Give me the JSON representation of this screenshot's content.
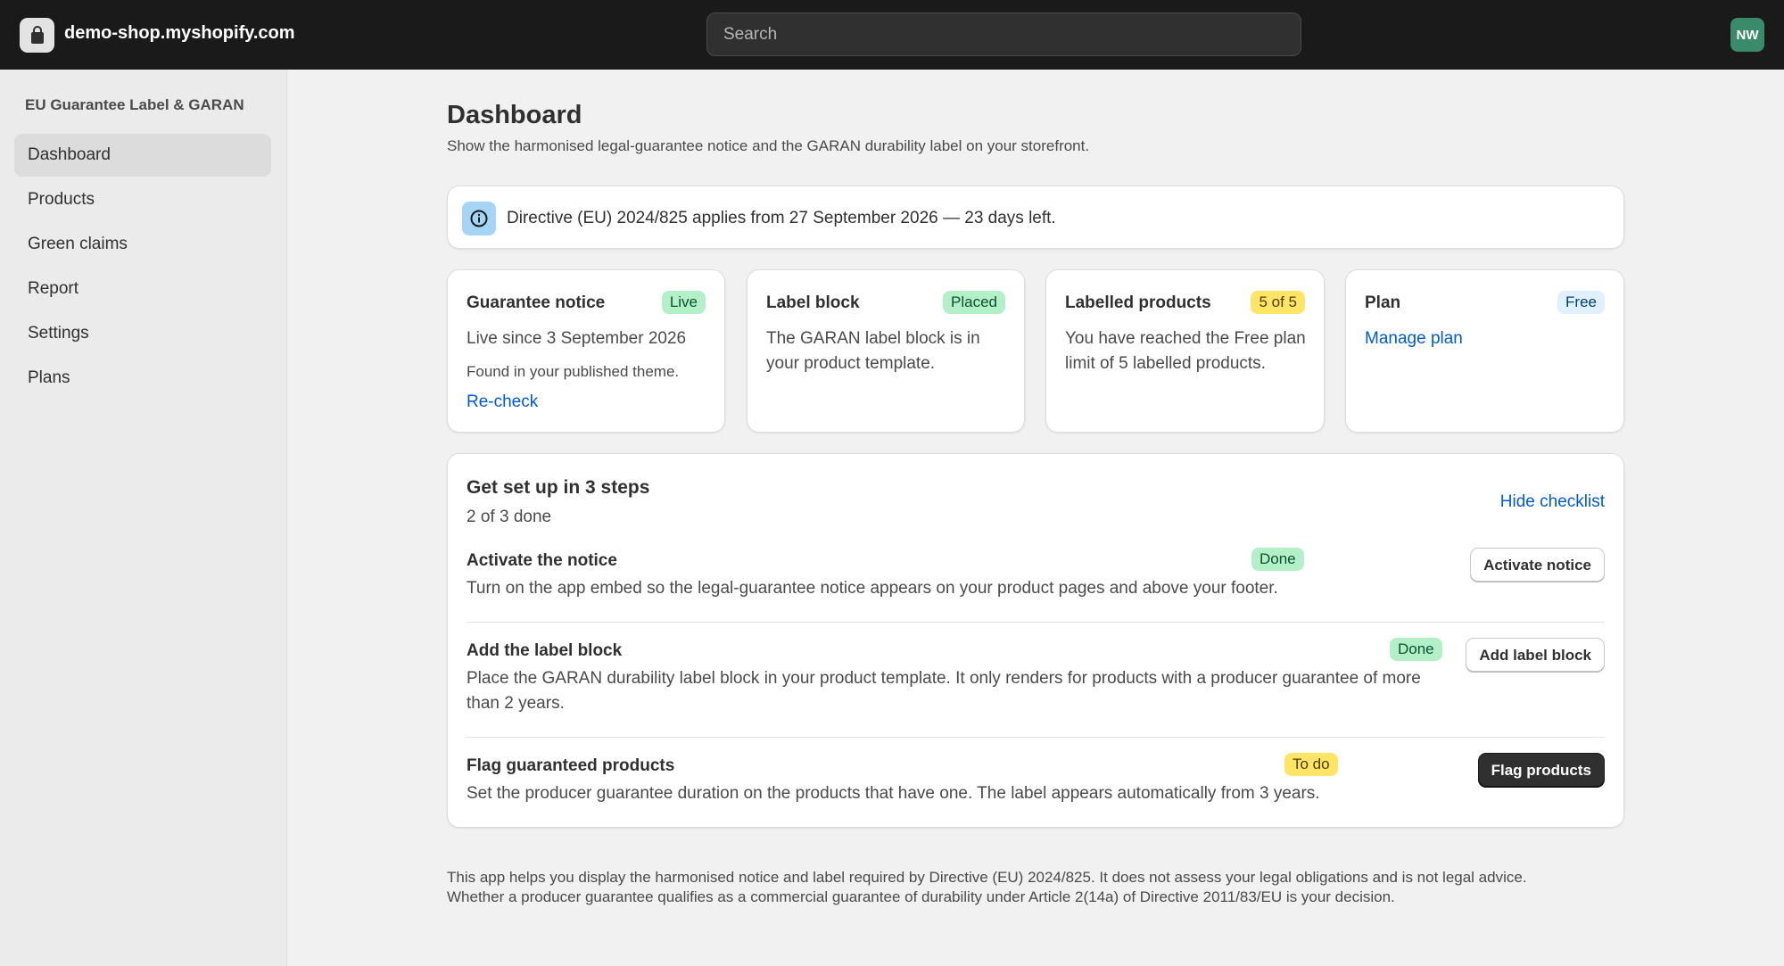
{
  "topbar": {
    "store_name": "demo-shop.myshopify.com",
    "search_placeholder": "Search",
    "avatar_initials": "NW"
  },
  "sidebar": {
    "app_name": "EU Guarantee Label & GARAN",
    "items": [
      {
        "label": "Dashboard",
        "active": true
      },
      {
        "label": "Products"
      },
      {
        "label": "Green claims"
      },
      {
        "label": "Report"
      },
      {
        "label": "Settings"
      },
      {
        "label": "Plans"
      }
    ]
  },
  "page": {
    "title": "Dashboard",
    "subtitle": "Show the harmonised legal-guarantee notice and the GARAN durability label on your storefront."
  },
  "banner": {
    "text": "Directive (EU) 2024/825 applies from 27 September 2026 — 23 days left."
  },
  "cards": {
    "notice": {
      "title": "Guarantee notice",
      "badge": "Live",
      "body": "Live since 3 September 2026",
      "small": "Found in your published theme.",
      "link": "Re-check"
    },
    "label": {
      "title": "Label block",
      "badge": "Placed",
      "body": "The GARAN label block is in your product template."
    },
    "products": {
      "title": "Labelled products",
      "badge": "5 of 5",
      "body": "You have reached the Free plan limit of 5 labelled products."
    },
    "plan": {
      "title": "Plan",
      "badge": "Free",
      "link": "Manage plan"
    }
  },
  "setup": {
    "title": "Get set up in 3 steps",
    "count": "2 of 3 done",
    "hide_link": "Hide checklist",
    "steps": [
      {
        "title": "Activate the notice",
        "badge": "Done",
        "desc": "Turn on the app embed so the legal-guarantee notice appears on your product pages and above your footer.",
        "button": "Activate notice"
      },
      {
        "title": "Add the label block",
        "badge": "Done",
        "desc": "Place the GARAN durability label block in your product template. It only renders for products with a producer guarantee of more than 2 years.",
        "button": "Add label block"
      },
      {
        "title": "Flag guaranteed products",
        "badge": "To do",
        "desc": "Set the producer guarantee duration on the products that have one. The label appears automatically from 3 years.",
        "button": "Flag products"
      }
    ]
  },
  "footer": {
    "line1": "This app helps you display the harmonised notice and label required by Directive (EU) 2024/825. It does not assess your legal obligations and is not legal advice.",
    "line2": "Whether a producer guarantee qualifies as a commercial guarantee of durability under Article 2(14a) of Directive 2011/83/EU is your decision."
  }
}
